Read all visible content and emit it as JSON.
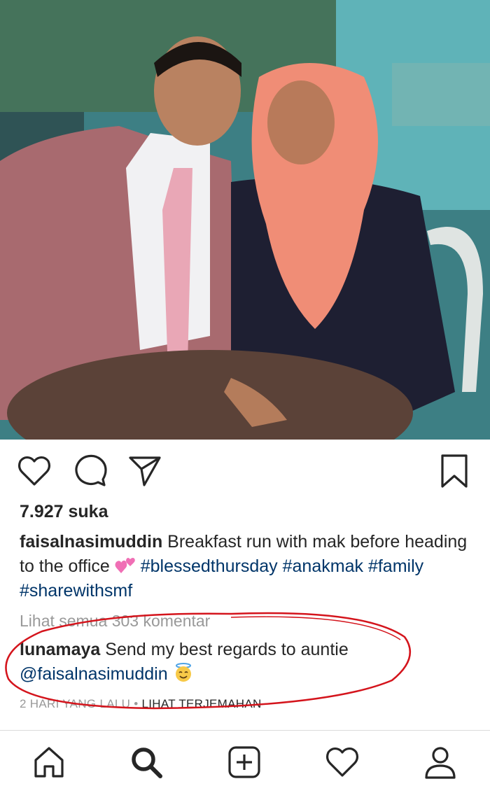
{
  "post": {
    "photo_alt": "photo",
    "likes": "7.927 suka",
    "caption": {
      "username": "faisalnasimuddin",
      "text": "Breakfast run with mak before heading to the office",
      "emoji": "two-hearts",
      "hashtags": [
        "#blessedthursday",
        "#anakmak",
        "#family",
        "#sharewithsmf"
      ]
    },
    "view_all_comments": "Lihat semua 303 komentar",
    "comment": {
      "username": "lunamaya",
      "text": "Send my best regards to auntie",
      "mention": "@faisalnasimuddin",
      "emoji": "smiling-face-with-halo"
    },
    "timestamp": "2 HARI YANG LALU",
    "separator": "•",
    "translate": "LIHAT TERJEMAHAN"
  },
  "actions": {
    "like": "heart-icon",
    "comment": "comment-icon",
    "share": "paper-plane-icon",
    "save": "bookmark-icon"
  },
  "bottom_nav": [
    "home-icon",
    "search-icon",
    "add-icon",
    "heart-icon",
    "profile-icon"
  ],
  "colors": {
    "text": "#262626",
    "link": "#003569",
    "muted": "#999999",
    "annotation": "#d4141c"
  }
}
